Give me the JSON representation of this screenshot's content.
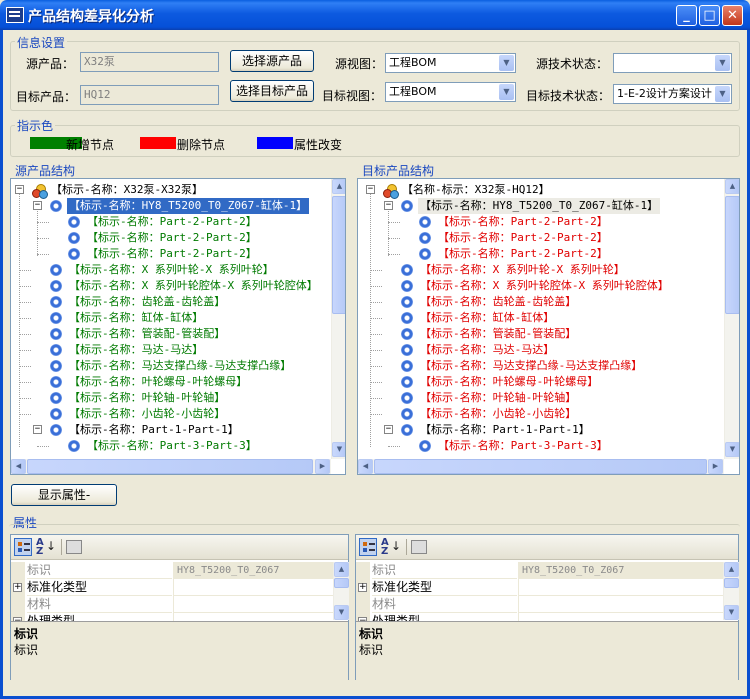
{
  "window": {
    "title": "产品结构差异化分析",
    "minimize": "_",
    "maximize": "□",
    "close": "✕"
  },
  "info": {
    "group_label": "信息设置",
    "source_product_label": "源产品：",
    "source_product_value": "X32泵",
    "target_product_label": "目标产品：",
    "target_product_value": "HQ12",
    "select_source_button": "选择源产品",
    "select_target_button": "选择目标产品",
    "source_view_label": "源视图：",
    "source_view_value": "工程BOM",
    "target_view_label": "目标视图：",
    "target_view_value": "工程BOM",
    "source_tech_label": "源技术状态：",
    "source_tech_value": "",
    "target_tech_label": "目标技术状态：",
    "target_tech_value": "1-E-2设计方案设计"
  },
  "legend": {
    "group_label": "指示色",
    "items": [
      {
        "label": "新增节点",
        "color": "#008000"
      },
      {
        "label": "删除节点",
        "color": "#ff0000"
      },
      {
        "label": "属性改变",
        "color": "#0000ff"
      }
    ]
  },
  "source_tree": {
    "group_label": "源产品结构",
    "rows": [
      "【标示-名称：X32泵-X32泵】",
      "【标示-名称：HY8_T5200_T0_Z067-缸体-1】",
      "【标示-名称：Part-2-Part-2】",
      "【标示-名称：Part-2-Part-2】",
      "【标示-名称：Part-2-Part-2】",
      "【标示-名称：X 系列叶轮-X 系列叶轮】",
      "【标示-名称：X 系列叶轮腔体-X 系列叶轮腔体】",
      "【标示-名称：齿轮盖-齿轮盖】",
      "【标示-名称：缸体-缸体】",
      "【标示-名称：管装配-管装配】",
      "【标示-名称：马达-马达】",
      "【标示-名称：马达支撑凸缘-马达支撑凸缘】",
      "【标示-名称：叶轮螺母-叶轮螺母】",
      "【标示-名称：叶轮轴-叶轮轴】",
      "【标示-名称：小齿轮-小齿轮】",
      "【标示-名称：Part-1-Part-1】",
      "【标示-名称：Part-3-Part-3】"
    ]
  },
  "target_tree": {
    "group_label": "目标产品结构",
    "rows": [
      "【名称-标示：X32泵-HQ12】",
      "【标示-名称：HY8_T5200_T0_Z067-缸体-1】",
      "【标示-名称：Part-2-Part-2】",
      "【标示-名称：Part-2-Part-2】",
      "【标示-名称：Part-2-Part-2】",
      "【标示-名称：X 系列叶轮-X 系列叶轮】",
      "【标示-名称：X 系列叶轮腔体-X 系列叶轮腔体】",
      "【标示-名称：齿轮盖-齿轮盖】",
      "【标示-名称：缸体-缸体】",
      "【标示-名称：管装配-管装配】",
      "【标示-名称：马达-马达】",
      "【标示-名称：马达支撑凸缘-马达支撑凸缘】",
      "【标示-名称：叶轮螺母-叶轮螺母】",
      "【标示-名称：叶轮轴-叶轮轴】",
      "【标示-名称：小齿轮-小齿轮】",
      "【标示-名称：Part-1-Part-1】",
      "【标示-名称：Part-3-Part-3】"
    ]
  },
  "show_props_button": "显示属性-",
  "props": {
    "group_label": "属性",
    "left": {
      "rows": [
        {
          "name": "标识",
          "value": "HY8_T5200_T0_Z067"
        },
        {
          "name": "标准化类型",
          "value": ""
        },
        {
          "name": "材料",
          "value": ""
        },
        {
          "name": "处理类型",
          "value": ""
        }
      ],
      "desc_title": "标识",
      "desc_text": "标识"
    },
    "right": {
      "rows": [
        {
          "name": "标识",
          "value": "HY8_T5200_T0_Z067"
        },
        {
          "name": "标准化类型",
          "value": ""
        },
        {
          "name": "材料",
          "value": ""
        },
        {
          "name": "处理类型",
          "value": ""
        }
      ],
      "desc_title": "标识",
      "desc_text": "标识"
    }
  }
}
